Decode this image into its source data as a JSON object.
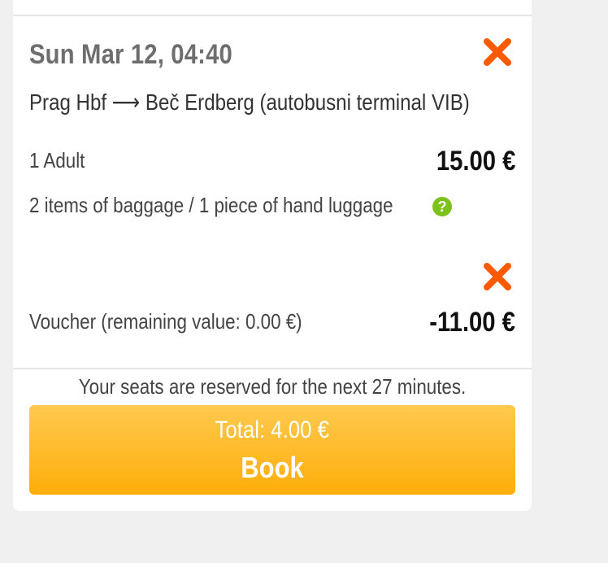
{
  "trip": {
    "date_time": "Sun Mar 12, 04:40",
    "route": "Prag Hbf ⟶ Beč Erdberg (autobusni terminal VIB)",
    "passengers_label": "1 Adult",
    "price": "15.00 €",
    "baggage_info": "2 items of baggage / 1 piece of hand luggage",
    "help_glyph": "?"
  },
  "voucher": {
    "label": "Voucher (remaining value: 0.00 €)",
    "amount": "-11.00 €"
  },
  "reservation_note": "Your seats are reserved for the next 27 minutes.",
  "book": {
    "total": "Total: 4.00 €",
    "label": "Book"
  },
  "icons": {
    "remove": "close-icon",
    "help": "question-icon"
  },
  "colors": {
    "remove": "#ff5a00",
    "help": "#7cc21a",
    "book_top": "#ffc94f",
    "book_bottom": "#ffae0a"
  }
}
